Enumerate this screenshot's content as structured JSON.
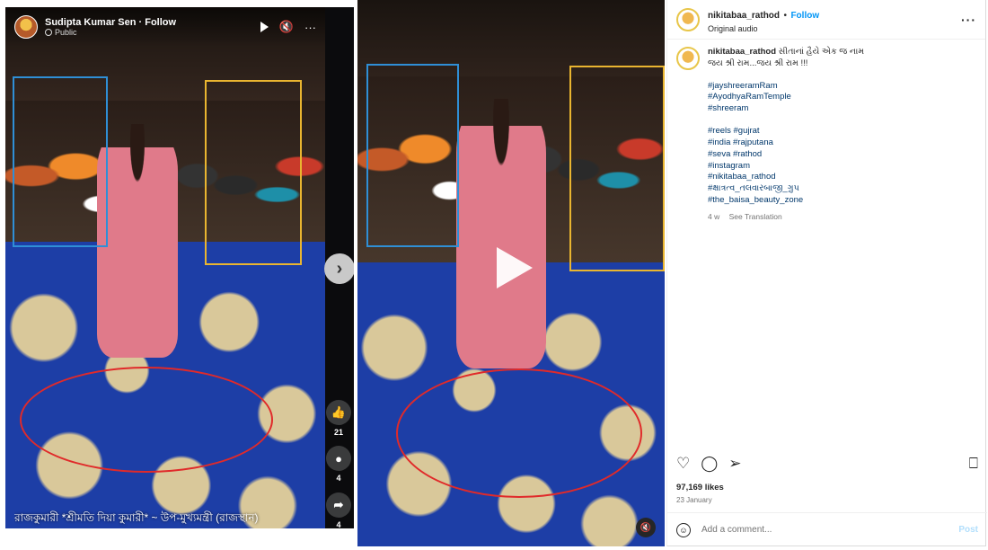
{
  "colors": {
    "blue_box": "#2f8fd6",
    "yellow_box": "#e9b530",
    "red_ellipse": "#e02a2a",
    "ig_follow": "#0095f6",
    "ig_hashtag": "#00376b"
  },
  "facebook": {
    "author": "Sudipta Kumar Sen · Follow",
    "privacy": "Public",
    "controls": {
      "play": "play-icon",
      "mute": "volume-muted-icon",
      "more": "···"
    },
    "next_icon": "›",
    "reactions": {
      "likes": "21",
      "comments": "4",
      "shares": "4"
    },
    "caption": "রাজকুমারী *শ্রীমতি দিয়া কুমারী* ~ উপ-মুখ্যমন্ত্রী (রাজস্থান)"
  },
  "instagram": {
    "username": "nikitabaa_rathod",
    "follow_sep": "•",
    "follow": "Follow",
    "audio": "Original audio",
    "more": "···",
    "caption_user": "nikitabaa_rathod",
    "caption_line1": "સીતાનાં હૈયે એક જ નામ",
    "caption_line2": "જય શ્રી રામ...જય શ્રી રામ !!!",
    "hashtags_group1": [
      "#jayshreeramRam",
      "#AyodhyaRamTemple",
      "#shreeram"
    ],
    "hashtags_group2": [
      "#reels #gujrat",
      "#india #rajputana",
      "#seva #rathod",
      "#instagram",
      "#nikitabaa_rathod",
      "#ક્ષાત્રત્વ_તલવારબાજી_ગ્રુપ",
      "#the_baisa_beauty_zone"
    ],
    "age": "4 w",
    "see_translation": "See Translation",
    "likes": "97,169 likes",
    "date": "23 January",
    "comment_placeholder": "Add a comment...",
    "post": "Post"
  }
}
